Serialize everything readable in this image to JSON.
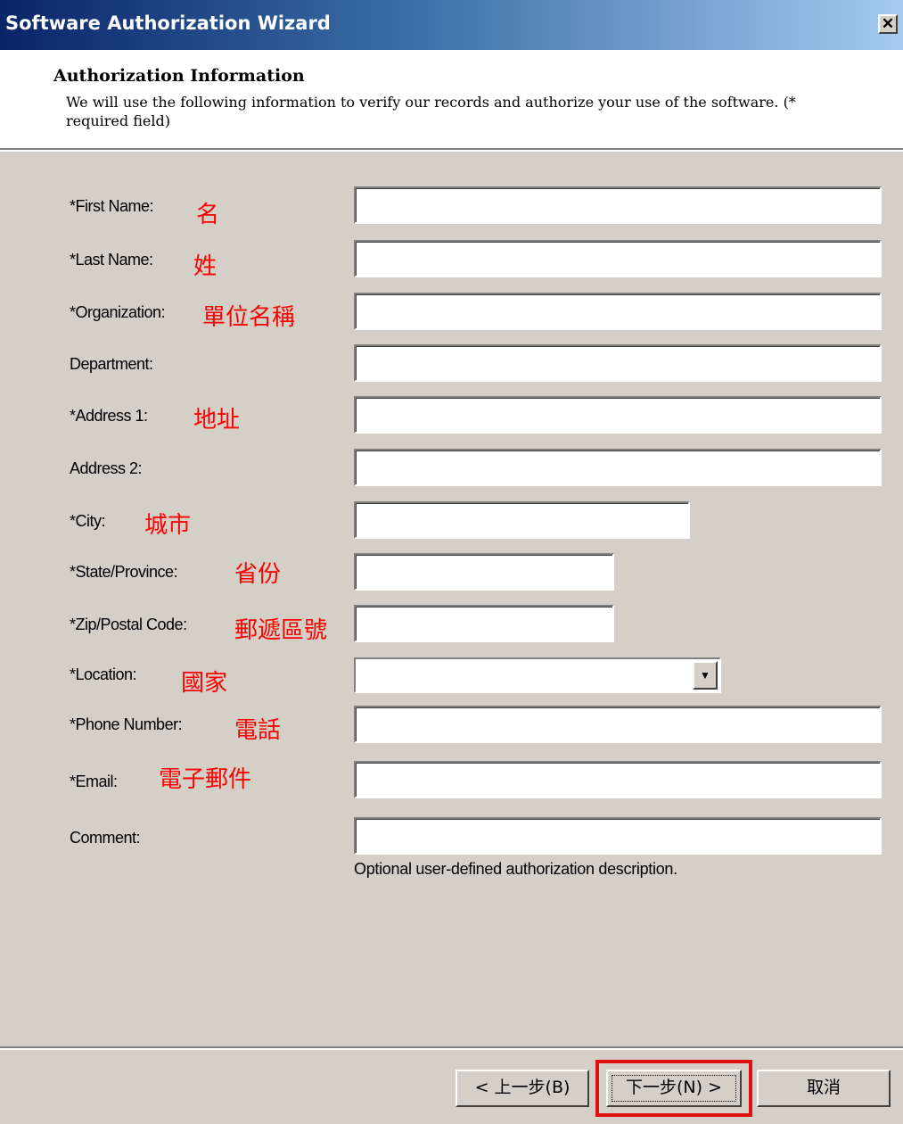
{
  "window": {
    "title": "Software Authorization Wizard",
    "close_label": "✕"
  },
  "header": {
    "title": "Authorization Information",
    "description": "We will use the following information to verify our records and authorize your use of the software. (* required field)"
  },
  "fields": {
    "first_name": {
      "label": "*First Name:",
      "annotation": "名",
      "value": ""
    },
    "last_name": {
      "label": "*Last Name:",
      "annotation": "姓",
      "value": ""
    },
    "organization": {
      "label": "*Organization:",
      "annotation": "單位名稱",
      "value": ""
    },
    "department": {
      "label": "Department:",
      "value": ""
    },
    "address1": {
      "label": "*Address 1:",
      "annotation": "地址",
      "value": ""
    },
    "address2": {
      "label": "Address 2:",
      "value": ""
    },
    "city": {
      "label": "*City:",
      "annotation": "城市",
      "value": ""
    },
    "state": {
      "label": "*State/Province:",
      "annotation": "省份",
      "value": ""
    },
    "zip": {
      "label": "*Zip/Postal Code:",
      "annotation": "郵遞區號",
      "value": ""
    },
    "location": {
      "label": "*Location:",
      "annotation": "國家",
      "value": ""
    },
    "phone": {
      "label": "*Phone Number:",
      "annotation": "電話",
      "value": ""
    },
    "email": {
      "label": "*Email:",
      "annotation": "電子郵件",
      "value": ""
    },
    "comment": {
      "label": "Comment:",
      "value": "",
      "hint": "Optional user-defined authorization description."
    }
  },
  "buttons": {
    "back": "< 上一步(B)",
    "next": "下一步(N) >",
    "cancel": "取消"
  },
  "colors": {
    "annotation": "#ff0000",
    "highlight": "#e01010",
    "dialog_bg": "#d4d0c8"
  }
}
